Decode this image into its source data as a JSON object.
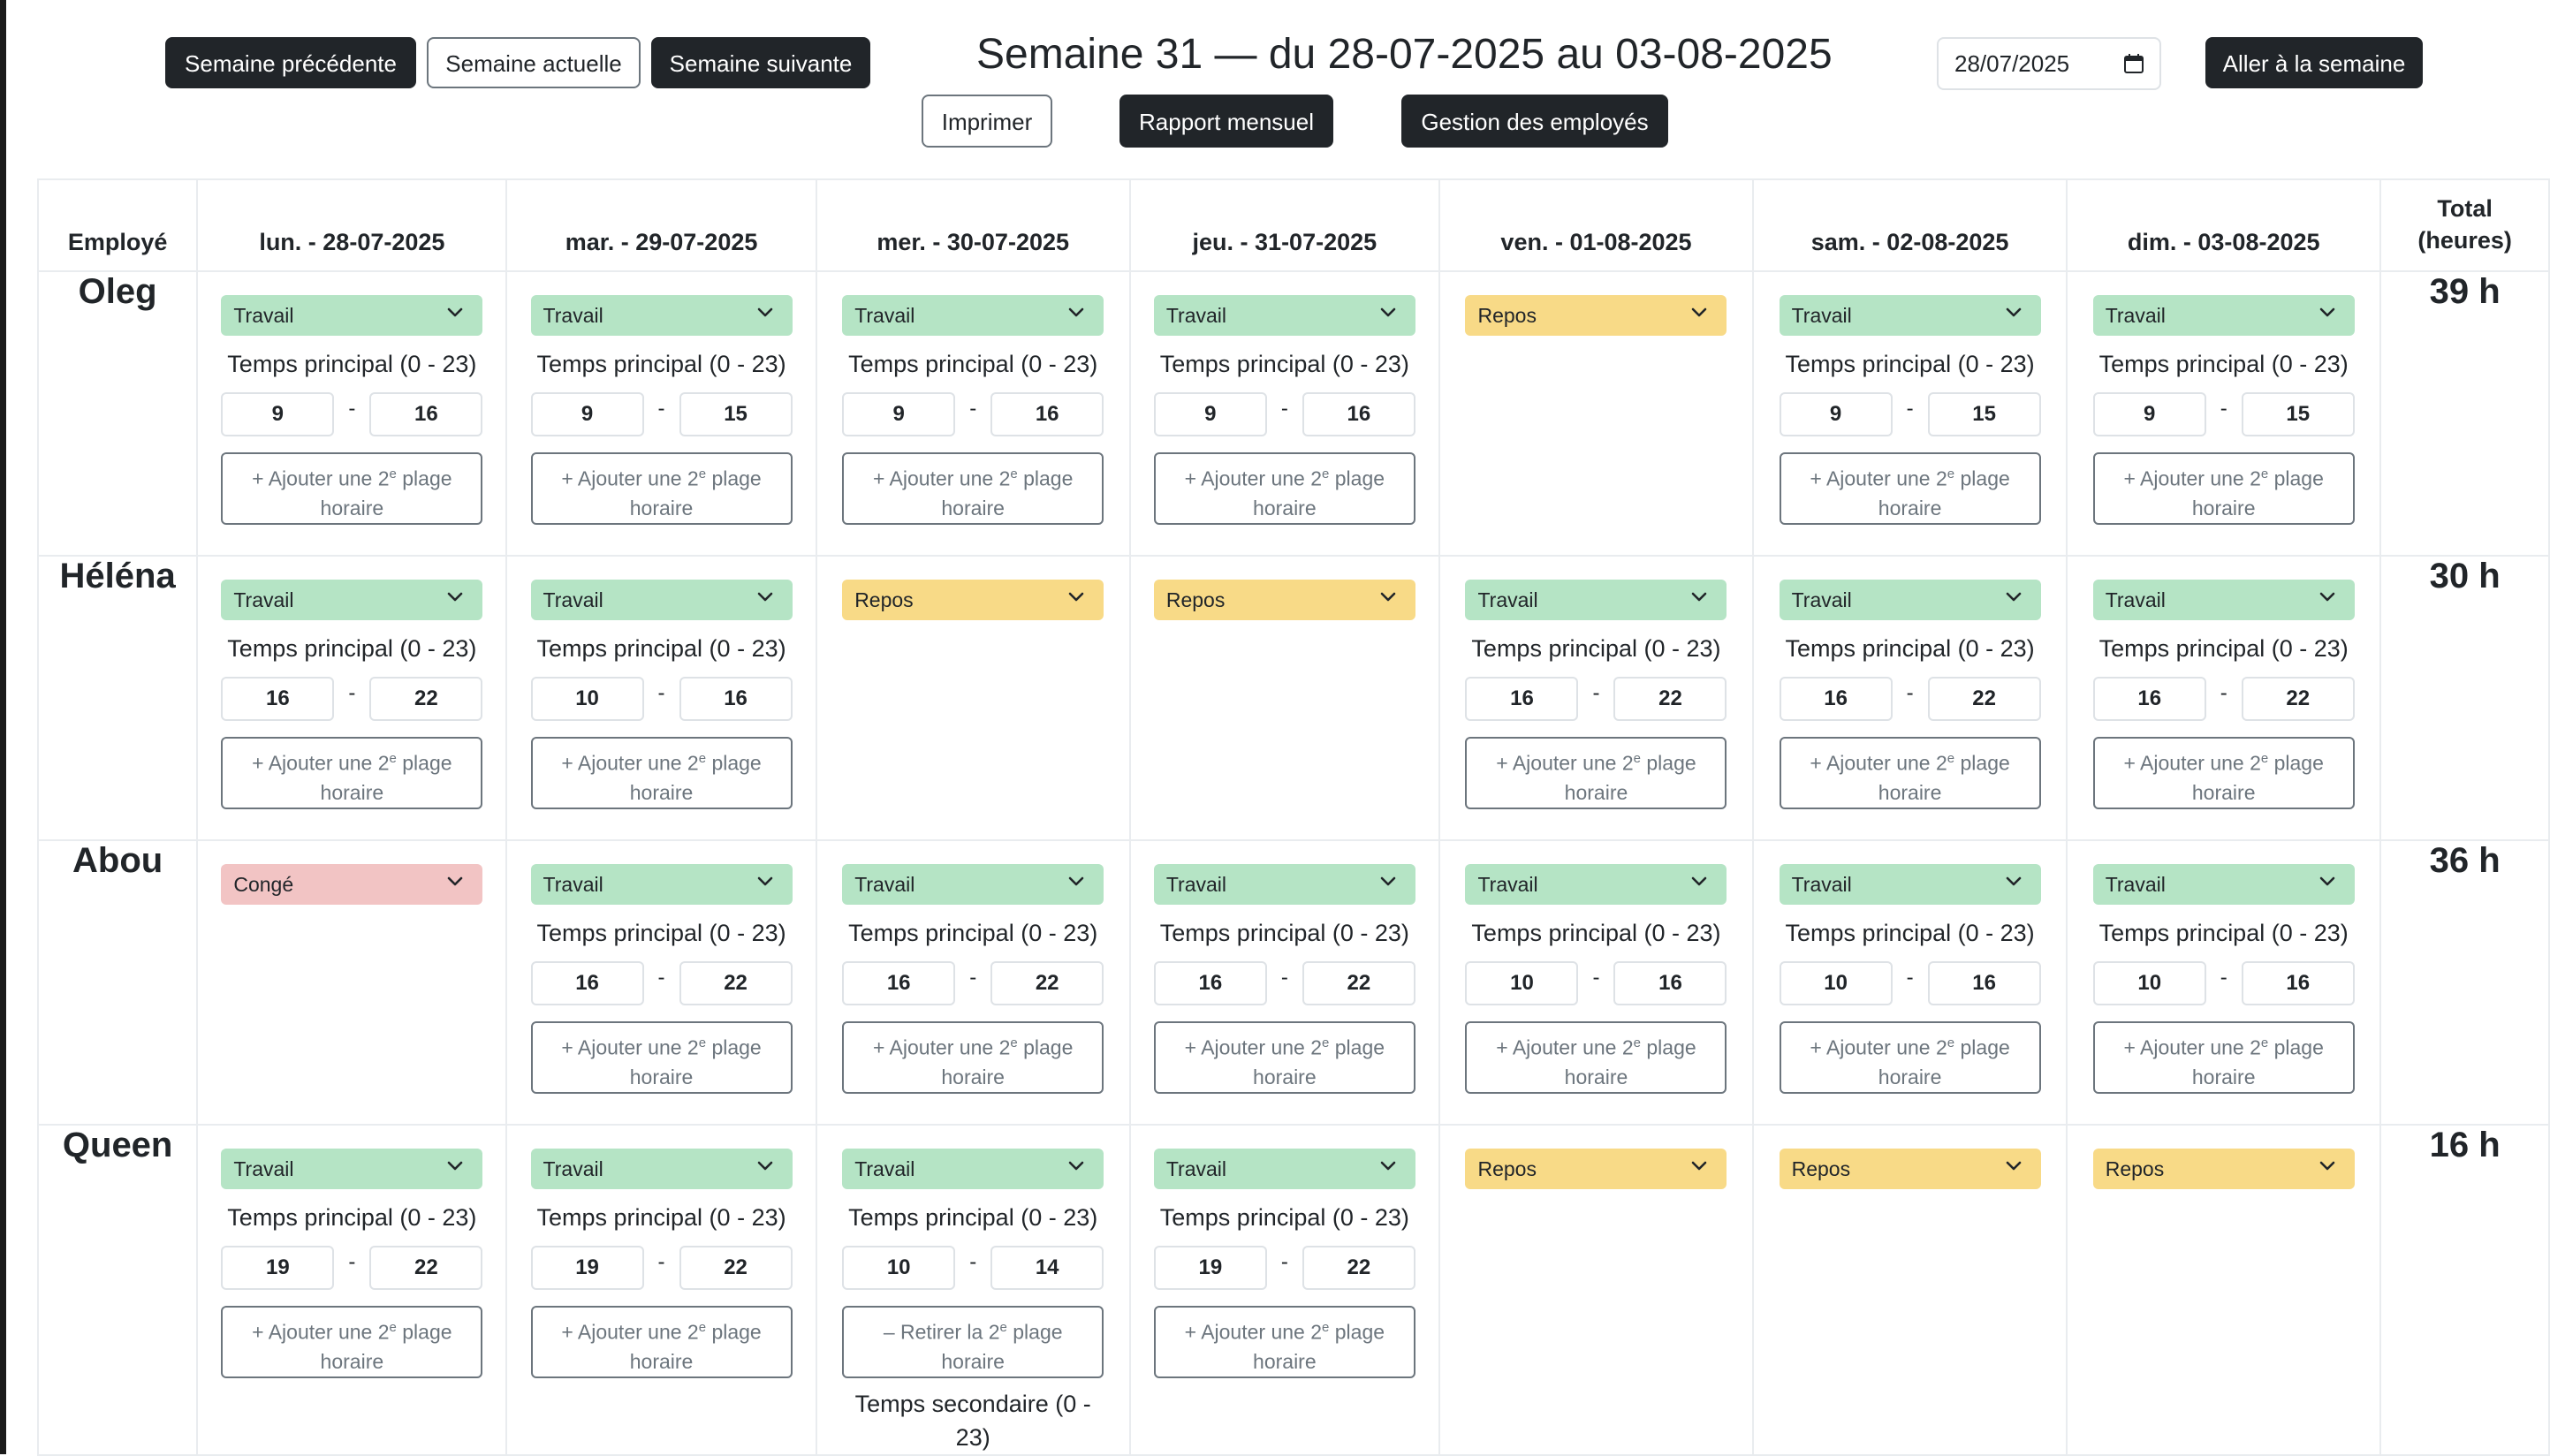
{
  "nav": {
    "prev_week": "Semaine précédente",
    "current_week": "Semaine actuelle",
    "next_week": "Semaine suivante",
    "print": "Imprimer",
    "monthly_report": "Rapport mensuel",
    "manage_employees": "Gestion des employés",
    "go_to_week": "Aller à la semaine",
    "date_value": "28/07/2025"
  },
  "week_title": "Semaine 31 — du 28-07-2025 au 03-08-2025",
  "table": {
    "employee_header": "Employé",
    "total_header_line1": "Total",
    "total_header_line2": "(heures)",
    "days": [
      "lun. - 28-07-2025",
      "mar. - 29-07-2025",
      "mer. - 30-07-2025",
      "jeu. - 31-07-2025",
      "ven. - 01-08-2025",
      "sam. - 02-08-2025",
      "dim. - 03-08-2025"
    ]
  },
  "labels": {
    "main_time": "Temps principal (0 - 23)",
    "second_time": "Temps secondaire (0 - 23)",
    "add_slot_prefix": "+ Ajouter une 2",
    "remove_slot_prefix": "– Retirer la 2",
    "slot_suffix_sup": "e",
    "slot_suffix_line1": " plage",
    "slot_suffix_line2": "horaire"
  },
  "colors": {
    "travail": "#b5e4c5",
    "repos": "#f8da87",
    "conge": "#f2c4c4",
    "dark_button": "#212529"
  },
  "employees": [
    {
      "name": "Oleg",
      "total": "39 h",
      "days": [
        {
          "status": "Travail",
          "start": "9",
          "end": "16"
        },
        {
          "status": "Travail",
          "start": "9",
          "end": "15"
        },
        {
          "status": "Travail",
          "start": "9",
          "end": "16"
        },
        {
          "status": "Travail",
          "start": "9",
          "end": "16"
        },
        {
          "status": "Repos"
        },
        {
          "status": "Travail",
          "start": "9",
          "end": "15"
        },
        {
          "status": "Travail",
          "start": "9",
          "end": "15"
        }
      ]
    },
    {
      "name": "Héléna",
      "total": "30 h",
      "days": [
        {
          "status": "Travail",
          "start": "16",
          "end": "22"
        },
        {
          "status": "Travail",
          "start": "10",
          "end": "16"
        },
        {
          "status": "Repos"
        },
        {
          "status": "Repos"
        },
        {
          "status": "Travail",
          "start": "16",
          "end": "22"
        },
        {
          "status": "Travail",
          "start": "16",
          "end": "22"
        },
        {
          "status": "Travail",
          "start": "16",
          "end": "22"
        }
      ]
    },
    {
      "name": "Abou",
      "total": "36 h",
      "days": [
        {
          "status": "Congé"
        },
        {
          "status": "Travail",
          "start": "16",
          "end": "22"
        },
        {
          "status": "Travail",
          "start": "16",
          "end": "22"
        },
        {
          "status": "Travail",
          "start": "16",
          "end": "22"
        },
        {
          "status": "Travail",
          "start": "10",
          "end": "16"
        },
        {
          "status": "Travail",
          "start": "10",
          "end": "16"
        },
        {
          "status": "Travail",
          "start": "10",
          "end": "16"
        }
      ]
    },
    {
      "name": "Queen",
      "total": "16 h",
      "days": [
        {
          "status": "Travail",
          "start": "19",
          "end": "22"
        },
        {
          "status": "Travail",
          "start": "19",
          "end": "22"
        },
        {
          "status": "Travail",
          "start": "10",
          "end": "14",
          "second_slot": true,
          "second_label_line1": "Temps secondaire (0 -",
          "second_label_line2": "23)"
        },
        {
          "status": "Travail",
          "start": "19",
          "end": "22"
        },
        {
          "status": "Repos"
        },
        {
          "status": "Repos"
        },
        {
          "status": "Repos"
        }
      ]
    }
  ]
}
